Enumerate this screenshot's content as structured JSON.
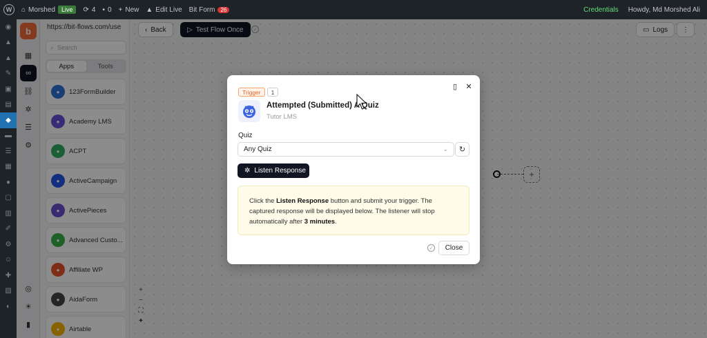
{
  "adminbar": {
    "site_name": "Morshed",
    "live_label": "Live",
    "updates_count": "4",
    "comments_count": "0",
    "new_label": "New",
    "edit_live_label": "Edit Live",
    "bitform_label": "Bit Form",
    "bitform_count": "26",
    "credentials_label": "Credentials",
    "howdy_label": "Howdy, Md Morshed Ali"
  },
  "panel": {
    "url": "https://bit-flows.com/use",
    "search_placeholder": "Search",
    "tabs": [
      "Apps",
      "Tools"
    ],
    "apps": [
      {
        "name": "123FormBuilder",
        "icon": "123formbuilder-icon",
        "color": "#2f6fd6"
      },
      {
        "name": "Academy LMS",
        "icon": "academy-lms-icon",
        "color": "#6a4fd8"
      },
      {
        "name": "ACPT",
        "icon": "acpt-icon",
        "color": "#2fae63"
      },
      {
        "name": "ActiveCampaign",
        "icon": "activecampaign-icon",
        "color": "#2156e8"
      },
      {
        "name": "ActivePieces",
        "icon": "activepieces-icon",
        "color": "#6b4ed0"
      },
      {
        "name": "Advanced Custo...",
        "icon": "acf-icon",
        "color": "#33b24a"
      },
      {
        "name": "Affiliate WP",
        "icon": "affiliatewp-icon",
        "color": "#e8532b"
      },
      {
        "name": "AidaForm",
        "icon": "aidaform-icon",
        "color": "#444444"
      },
      {
        "name": "Airtable",
        "icon": "airtable-icon",
        "color": "#f5b400"
      }
    ]
  },
  "toolbar": {
    "back_label": "Back",
    "test_flow_label": "Test Flow Once",
    "logs_label": "Logs"
  },
  "modal": {
    "trigger_badge": "Trigger",
    "step_number": "1",
    "title": "Attempted (Submitted) A Quiz",
    "subtitle": "Tutor LMS",
    "quiz_label": "Quiz",
    "quiz_value": "Any Quiz",
    "listen_button": "Listen Response",
    "info_text_1": "Click the ",
    "info_bold_1": "Listen Response",
    "info_text_2": " button and submit your trigger. The captured response will be displayed below. The listener will stop automatically after ",
    "info_bold_2": "3 minutes",
    "info_text_3": ".",
    "close_button": "Close"
  },
  "colors": {
    "accent_dark": "#121522",
    "brand_orange": "#f26b3a",
    "trigger_orange": "#e0652a",
    "info_bg": "#fffbe9",
    "wp_admin": "#1d2327"
  }
}
